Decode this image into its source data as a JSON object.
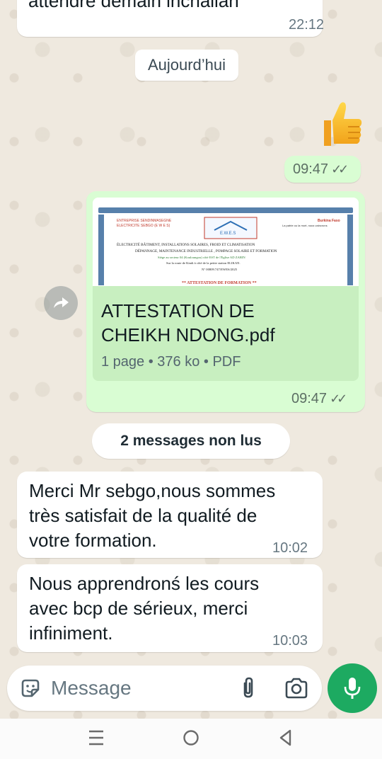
{
  "previous_message": {
    "text": "attendre demain inchallah",
    "time": "22:12"
  },
  "date_separator": "Aujourd’hui",
  "emoji_message": {
    "emoji": "thumbs-up-emoji",
    "time": "09:47",
    "status": "read"
  },
  "document_message": {
    "preview_lines": [
      "ENTREPRISE SENDINMASEGNE",
      "ELECTRICITE SEBGO (E W E S)",
      "Burkina Faso",
      "La patrie ou la mort, nous vaincrons",
      "ÉLECTRICITÉ BÂTIMENT, INSTALLATIONS SOLAIRES, FROID ET CLIMATISATION",
      "DÉPANNAGE, MAINTENANCE INDUSTRIELLE , POMPAGE SOLAIRE ET FORMATION",
      "Siège au secteur 04 (Kouloungou) côté EST de l'Eglise AD ZARIN",
      "Sur la route de Kindi à côté de la petite station ELIKAN.",
      "N° 00809.747/EWES/2025",
      "** ATTESTATION DE FORMATION **"
    ],
    "logo_text": "E.W.E.S",
    "filename_line1": "ATTESTATION DE",
    "filename_line2": "CHEIKH NDONG.pdf",
    "meta": "1 page • 376 ko • PDF",
    "time": "09:47",
    "status": "read"
  },
  "unread_separator": "2 messages non lus",
  "incoming_messages": [
    {
      "lines": [
        "Merci Mr sebgo,nous sommes",
        "très satisfait de la qualité de",
        "votre formation."
      ],
      "time": "10:02"
    },
    {
      "lines": [
        "Nous apprendronś les cours",
        "avec bcp de sérieux, merci",
        "infiniment."
      ],
      "time": "10:03"
    }
  ],
  "composer": {
    "placeholder": "Message"
  },
  "colors": {
    "outgoing_bubble": "#d9fdd3",
    "incoming_bubble": "#ffffff",
    "mic_button": "#1daa61",
    "wallpaper": "#efeae2"
  }
}
